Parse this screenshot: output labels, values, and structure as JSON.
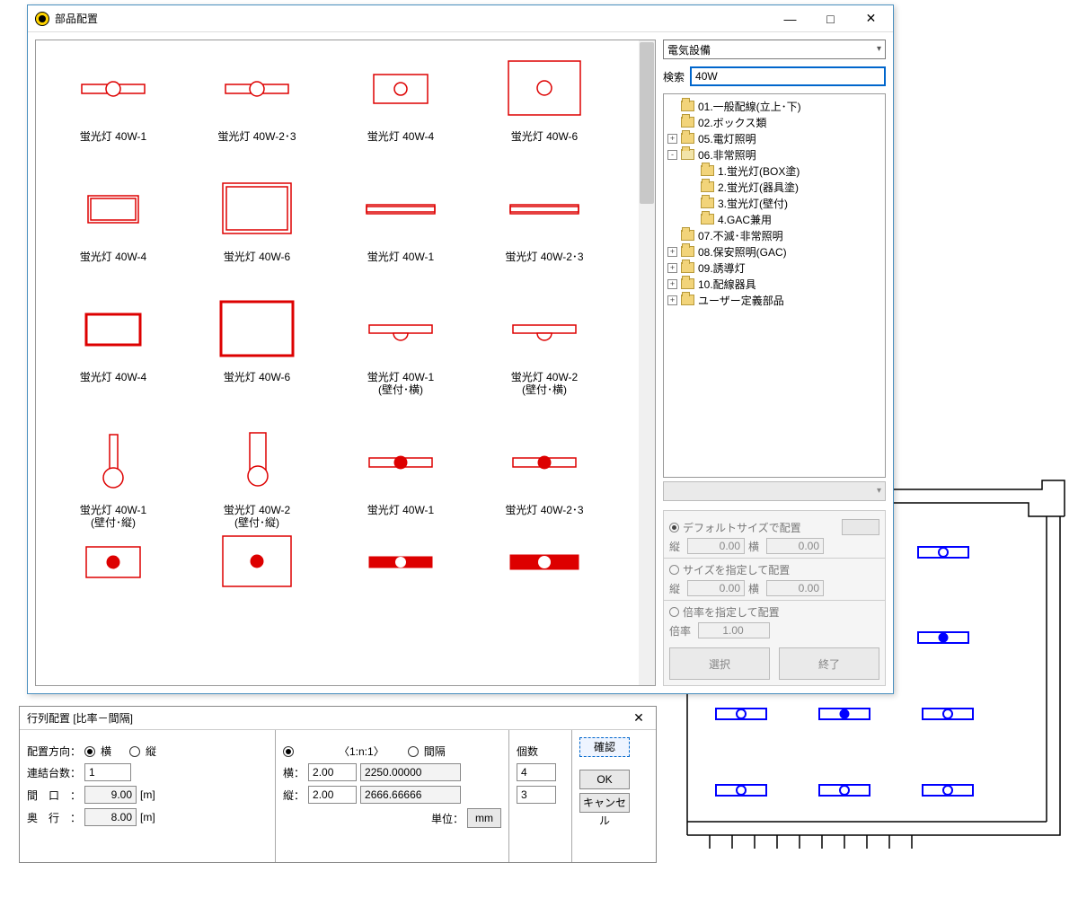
{
  "main_window": {
    "title": "部品配置",
    "minimize": "—",
    "maximize": "□",
    "close": "✕"
  },
  "category_dropdown": "電気設備",
  "search": {
    "label": "検索",
    "value": "40W"
  },
  "tree": [
    {
      "depth": 0,
      "exp": "",
      "label": "01.一般配線(立上･下)"
    },
    {
      "depth": 0,
      "exp": "",
      "label": "02.ボックス類"
    },
    {
      "depth": 0,
      "exp": "+",
      "label": "05.電灯照明"
    },
    {
      "depth": 0,
      "exp": "-",
      "label": "06.非常照明"
    },
    {
      "depth": 1,
      "exp": "",
      "label": "1.蛍光灯(BOX塗)"
    },
    {
      "depth": 1,
      "exp": "",
      "label": "2.蛍光灯(器具塗)"
    },
    {
      "depth": 1,
      "exp": "",
      "label": "3.蛍光灯(壁付)"
    },
    {
      "depth": 1,
      "exp": "",
      "label": "4.GAC兼用"
    },
    {
      "depth": 0,
      "exp": "",
      "label": "07.不滅･非常照明"
    },
    {
      "depth": 0,
      "exp": "+",
      "label": "08.保安照明(GAC)"
    },
    {
      "depth": 0,
      "exp": "+",
      "label": "09.誘導灯"
    },
    {
      "depth": 0,
      "exp": "+",
      "label": "10.配線器具"
    },
    {
      "depth": 0,
      "exp": "+",
      "label": "ユーザー定義部品"
    }
  ],
  "parts": [
    [
      {
        "label": "蛍光灯 40W-1",
        "sym": "bar_circle"
      },
      {
        "label": "蛍光灯 40W-2･3",
        "sym": "bar_circle"
      },
      {
        "label": "蛍光灯 40W-4",
        "sym": "rect_circle_small"
      },
      {
        "label": "蛍光灯 40W-6",
        "sym": "rect_circle_big"
      }
    ],
    [
      {
        "label": "蛍光灯 40W-4",
        "sym": "rect_dbl"
      },
      {
        "label": "蛍光灯 40W-6",
        "sym": "rect_dbl_big"
      },
      {
        "label": "蛍光灯 40W-1",
        "sym": "bar_dbl"
      },
      {
        "label": "蛍光灯 40W-2･3",
        "sym": "bar_dbl"
      }
    ],
    [
      {
        "label": "蛍光灯 40W-4",
        "sym": "rect_thick"
      },
      {
        "label": "蛍光灯 40W-6",
        "sym": "rect_thick_big"
      },
      {
        "label": "蛍光灯 40W-1\n(壁付･横)",
        "sym": "bar_semi_down"
      },
      {
        "label": "蛍光灯 40W-2\n(壁付･横)",
        "sym": "bar_semi_down"
      }
    ],
    [
      {
        "label": "蛍光灯 40W-1\n(壁付･縦)",
        "sym": "vert_circle"
      },
      {
        "label": "蛍光灯 40W-2\n(壁付･縦)",
        "sym": "vert_circle_rect"
      },
      {
        "label": "蛍光灯 40W-1",
        "sym": "bar_dot"
      },
      {
        "label": "蛍光灯 40W-2･3",
        "sym": "bar_dot"
      }
    ],
    [
      {
        "label": "",
        "sym": "rect_dot"
      },
      {
        "label": "",
        "sym": "rect_dot_big"
      },
      {
        "label": "",
        "sym": "bar_fill_white"
      },
      {
        "label": "",
        "sym": "bar_fill_white2"
      }
    ]
  ],
  "size_options": {
    "default_label": "デフォルトサイズで配置",
    "v_label": "縦",
    "h_label": "横",
    "default_v": "0.00",
    "default_h": "0.00",
    "specify_label": "サイズを指定して配置",
    "spec_v": "0.00",
    "spec_h": "0.00",
    "scale_label": "倍率を指定して配置",
    "scale_l": "倍率",
    "scale_val": "1.00",
    "select_btn": "選択",
    "exit_btn": "終了"
  },
  "arr_window": {
    "title": "行列配置 [比率－間隔]",
    "close": "✕",
    "dir_label": "配置方向：",
    "dir_h": "横",
    "dir_v": "縦",
    "link_label": "連結台数：",
    "link_val": "1",
    "mag_label": "間　口　：",
    "mag_val": "9.00",
    "mag_unit": "[m]",
    "dep_label": "奥　行　：",
    "dep_val": "8.00",
    "dep_unit": "[m]",
    "ratio": "〈1:n:1〉",
    "interval": "間隔",
    "h2": "横：",
    "h2v": "2.00",
    "h2calc": "2250.00000",
    "v2": "縦：",
    "v2v": "2.00",
    "v2calc": "2666.66666",
    "unit_label": "単位：",
    "unit_btn": "mm",
    "count_label": "個数",
    "count_h": "4",
    "count_v": "3",
    "confirm": "確認",
    "ok": "OK",
    "cancel": "キャンセル"
  }
}
